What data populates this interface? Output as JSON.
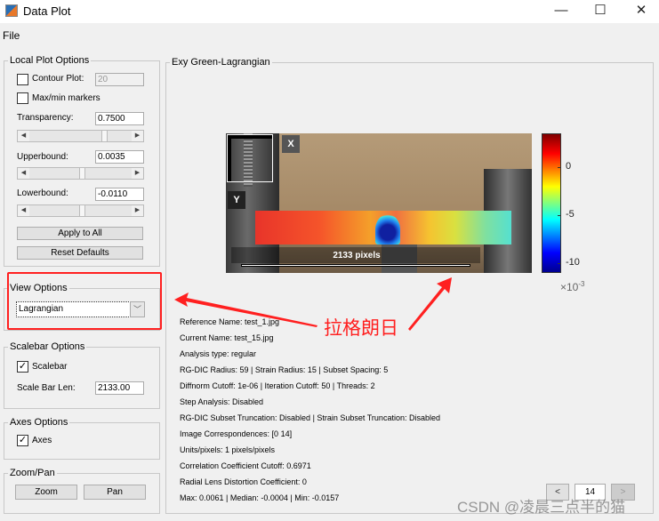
{
  "window": {
    "title": "Data Plot",
    "minimize": "—",
    "maximize": "☐",
    "close": "✕"
  },
  "menu": {
    "file": "File"
  },
  "local_plot_options": {
    "legend": "Local Plot Options",
    "contour_label": "Contour Plot:",
    "contour_checked": false,
    "contour_value": "20",
    "maxmin_label": "Max/min markers",
    "maxmin_checked": false,
    "transparency_label": "Transparency:",
    "transparency_value": "0.7500",
    "transparency_slider": 0.75,
    "upperbound_label": "Upperbound:",
    "upperbound_value": "0.0035",
    "upperbound_slider": 0.52,
    "lowerbound_label": "Lowerbound:",
    "lowerbound_value": "-0.0110",
    "lowerbound_slider": 0.52,
    "apply_label": "Apply to All",
    "reset_label": "Reset Defaults"
  },
  "view_options": {
    "legend": "View Options",
    "selected": "Lagrangian"
  },
  "scalebar_options": {
    "legend": "Scalebar Options",
    "scalebar_label": "Scalebar",
    "scalebar_checked": true,
    "len_label": "Scale Bar Len:",
    "len_value": "2133.00"
  },
  "axes_options": {
    "legend": "Axes Options",
    "axes_label": "Axes",
    "axes_checked": true
  },
  "zoom_pan": {
    "legend": "Zoom/Pan",
    "zoom_label": "Zoom",
    "pan_label": "Pan"
  },
  "plot": {
    "legend": "Exy Green-Lagrangian",
    "axis_x": "X",
    "axis_y": "Y",
    "scalebar_text": "2133 pixels",
    "colorbar": {
      "ticks": [
        "0",
        "-5",
        "-10"
      ],
      "tick_values": [
        0,
        -5,
        -10
      ],
      "range": [
        -11,
        3.5
      ],
      "colormap": "jet",
      "multiplier": "×10",
      "exponent": "-3"
    }
  },
  "info": [
    "Reference Name: test_1.jpg",
    "Current Name: test_15.jpg",
    "Analysis type: regular",
    "RG-DIC Radius: 59 | Strain Radius: 15 | Subset Spacing: 5",
    "Diffnorm Cutoff: 1e-06 | Iteration Cutoff: 50 | Threads: 2",
    "Step Analysis: Disabled",
    "RG-DIC Subset Truncation: Disabled | Strain Subset Truncation: Disabled",
    "Image Correspondences: [0 14]",
    "Units/pixels: 1 pixels/pixels",
    "Correlation Coefficient Cutoff: 0.6971",
    "Radial Lens Distortion Coefficient: 0",
    "Max: 0.0061 | Median: -0.0004 | Min: -0.0157"
  ],
  "pager": {
    "prev": "<",
    "value": "14",
    "next": ">"
  },
  "annotation": {
    "text": "拉格朗日",
    "color": "#ff2020"
  },
  "watermark": "CSDN @凌晨三点半的猫"
}
